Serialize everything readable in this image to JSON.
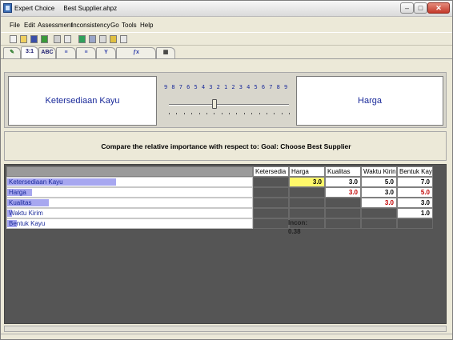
{
  "window": {
    "app_name": "Expert Choice",
    "file_name": "Best Supplier.ahpz",
    "min_symbol": "–",
    "max_symbol": "□",
    "close_symbol": "✕"
  },
  "menu": [
    "File",
    "Edit",
    "Assessment",
    "Inconsistency",
    "Go",
    "Tools",
    "Help"
  ],
  "toolbar_icons": [
    "new-icon",
    "open-icon",
    "save-icon",
    "check-icon",
    "print-icon",
    "preview-icon",
    "model-icon",
    "tree-icon",
    "calc-icon",
    "key-icon",
    "undo-icon"
  ],
  "tabs": [
    {
      "label": "",
      "icon": "tree-tab-icon"
    },
    {
      "label": "3:1",
      "icon": ""
    },
    {
      "label": "ABC",
      "icon": ""
    },
    {
      "label": "",
      "icon": "bar-tab-icon"
    },
    {
      "label": "",
      "icon": "sort-tab-icon"
    },
    {
      "label": "",
      "icon": "hierarchy-tab-icon"
    },
    {
      "label": "",
      "icon": "formula-tab-icon"
    },
    {
      "label": "",
      "icon": "grid-tab-icon"
    }
  ],
  "comparison": {
    "left_element": "Ketersediaan Kayu",
    "right_element": "Harga",
    "scale_numbers": [
      "9",
      "8",
      "7",
      "6",
      "5",
      "4",
      "3",
      "2",
      "1",
      "2",
      "3",
      "4",
      "5",
      "6",
      "7",
      "8",
      "9"
    ],
    "slider_value": 3,
    "slider_side": "left"
  },
  "question": "Compare the relative importance with respect to:  Goal: Choose Best Supplier",
  "matrix": {
    "columns": [
      "Ketersedia",
      "Harga",
      "Kualitas",
      "Waktu Kirin",
      "Bentuk Kay"
    ],
    "rows": [
      {
        "label": "Ketersediaan Kayu",
        "weight": 0.44,
        "cells": [
          "",
          "3.0",
          "3.0",
          "5.0",
          "7.0"
        ],
        "colors": [
          "grey",
          "yellow",
          "white",
          "white",
          "white"
        ],
        "text_colors": [
          "black",
          "black",
          "black",
          "black",
          "black"
        ]
      },
      {
        "label": "Harga",
        "weight": 0.1,
        "cells": [
          "",
          "",
          "3.0",
          "3.0",
          "5.0"
        ],
        "colors": [
          "grey",
          "grey",
          "white",
          "white",
          "white"
        ],
        "text_colors": [
          "black",
          "black",
          "red",
          "black",
          "red"
        ]
      },
      {
        "label": "Kualitas",
        "weight": 0.17,
        "cells": [
          "",
          "",
          "",
          "3.0",
          "3.0"
        ],
        "colors": [
          "grey",
          "grey",
          "grey",
          "white",
          "white"
        ],
        "text_colors": [
          "black",
          "black",
          "black",
          "red",
          "black"
        ]
      },
      {
        "label": "Waktu Kirim",
        "weight": 0.02,
        "cells": [
          "",
          "",
          "",
          "",
          "1.0"
        ],
        "colors": [
          "grey",
          "grey",
          "grey",
          "grey",
          "white"
        ],
        "text_colors": [
          "black",
          "black",
          "black",
          "black",
          "black"
        ]
      },
      {
        "label": "Bentuk Kayu",
        "weight": 0.04,
        "cells": [
          "",
          "",
          "",
          "",
          ""
        ],
        "colors": [
          "grey",
          "grey",
          "grey",
          "grey",
          "grey"
        ],
        "text_colors": [
          "black",
          "black",
          "black",
          "black",
          "black"
        ]
      }
    ],
    "inconsistency": "Incon: 0.38"
  },
  "colors": {
    "accent_blue": "#1a2a9a",
    "highlight_yellow": "#fff86a",
    "inverse_red": "#c00000",
    "weight_bar": "#a7a7f0"
  }
}
